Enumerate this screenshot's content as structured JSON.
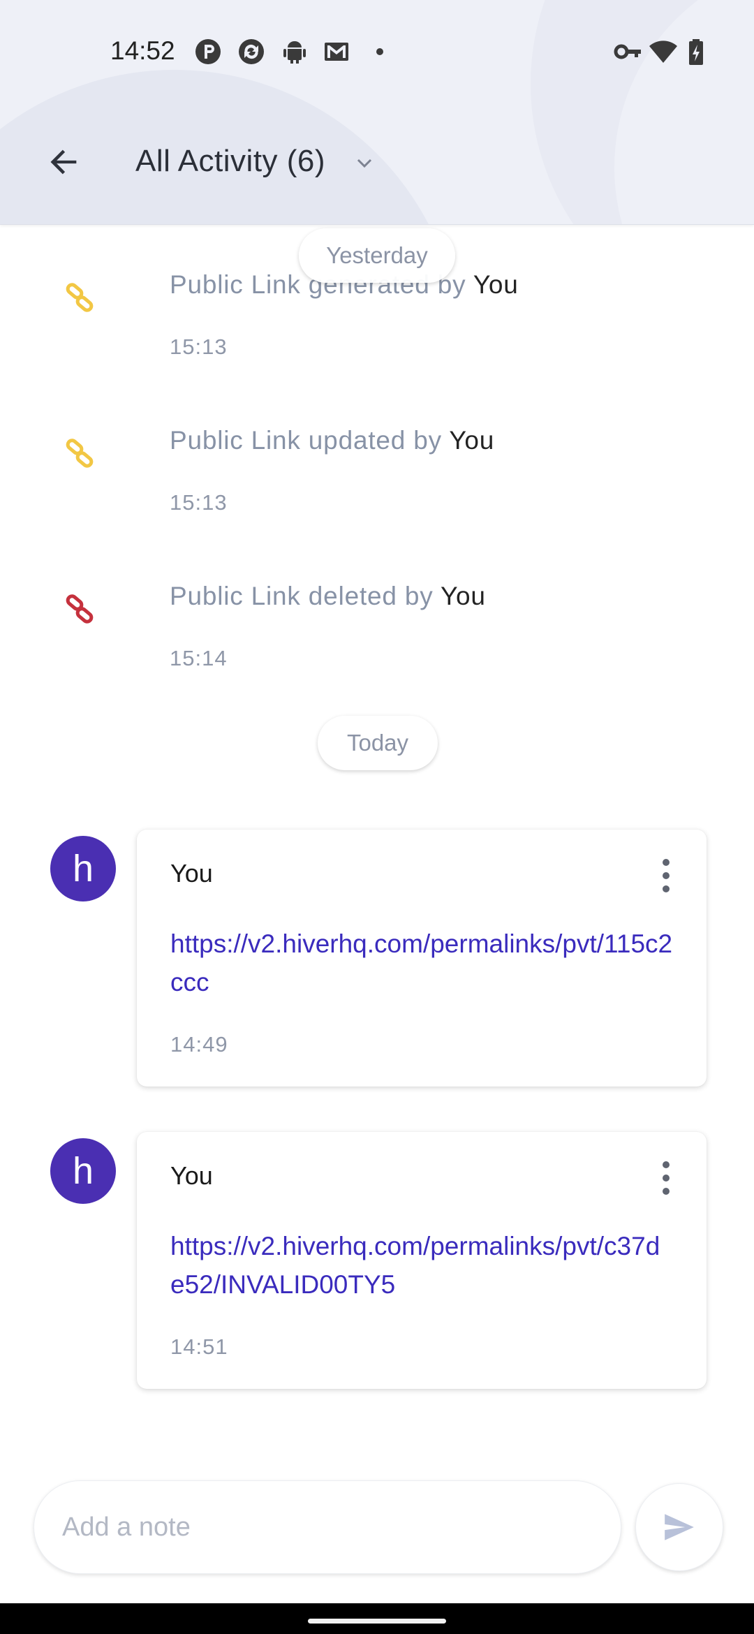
{
  "status_bar": {
    "time": "14:52",
    "left_icons": [
      "p-app-icon",
      "sync-app-icon",
      "android-icon",
      "gmail-icon",
      "dot-icon"
    ],
    "right_icons": [
      "vpn-key-icon",
      "wifi-icon",
      "battery-charging-icon"
    ]
  },
  "header": {
    "title": "All Activity (6)",
    "back_icon": "arrow-back-icon",
    "dropdown_icon": "chevron-down-icon"
  },
  "date_chips": {
    "yesterday": "Yesterday",
    "today": "Today"
  },
  "activities": [
    {
      "text": "Public Link generated by ",
      "actor": "You",
      "time": "15:13",
      "icon": "link-icon",
      "icon_color": "#f2c744"
    },
    {
      "text": "Public Link updated by ",
      "actor": "You",
      "time": "15:13",
      "icon": "link-icon",
      "icon_color": "#f2c744"
    },
    {
      "text": "Public Link deleted by ",
      "actor": "You",
      "time": "15:14",
      "icon": "link-off-icon",
      "icon_color": "#c5313d"
    }
  ],
  "notes": [
    {
      "avatar": "h",
      "author": "You",
      "link": "https://v2.hiverhq.com/permalinks/pvt/115c2ccc",
      "time": "14:49"
    },
    {
      "avatar": "h",
      "author": "You",
      "link": "https://v2.hiverhq.com/permalinks/pvt/c37de52/INVALID00TY5",
      "time": "14:51"
    }
  ],
  "composer": {
    "placeholder": "Add a note",
    "send_icon": "send-icon"
  },
  "colors": {
    "accent": "#4a2fb2",
    "link": "#3a2bbd",
    "header_bg": "#eef0f7",
    "muted_text": "#8792a6"
  }
}
